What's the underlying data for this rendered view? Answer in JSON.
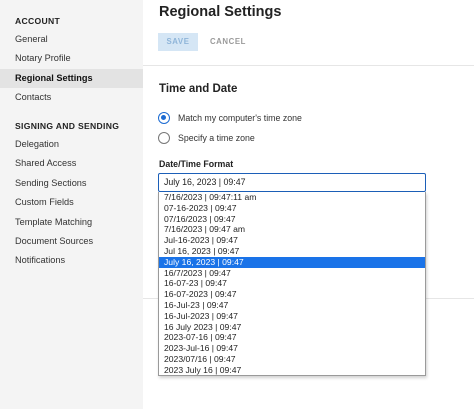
{
  "sidebar": {
    "account_heading": "ACCOUNT",
    "account_items": [
      {
        "label": "General",
        "active": false
      },
      {
        "label": "Notary Profile",
        "active": false
      },
      {
        "label": "Regional Settings",
        "active": true
      },
      {
        "label": "Contacts",
        "active": false
      }
    ],
    "signing_heading": "SIGNING AND SENDING",
    "signing_items": [
      {
        "label": "Delegation"
      },
      {
        "label": "Shared Access"
      },
      {
        "label": "Sending Sections"
      },
      {
        "label": "Custom Fields"
      },
      {
        "label": "Template Matching"
      },
      {
        "label": "Document Sources"
      },
      {
        "label": "Notifications"
      }
    ]
  },
  "main": {
    "title": "Regional Settings",
    "save_label": "SAVE",
    "cancel_label": "CANCEL",
    "section_title": "Time and Date",
    "radio_options": [
      {
        "label": "Match my computer's time zone",
        "checked": true
      },
      {
        "label": "Specify a time zone",
        "checked": false
      }
    ],
    "datetime_label": "Date/Time Format",
    "datetime_value": "July 16, 2023 | 09:47",
    "datetime_options": [
      "7/16/2023 | 09:47:11 am",
      "07-16-2023 | 09:47",
      "07/16/2023 | 09:47",
      "7/16/2023 | 09:47 am",
      "Jul-16-2023 | 09:47",
      "Jul 16, 2023 | 09:47",
      "July 16, 2023 | 09:47",
      "16/7/2023 | 09:47",
      "16-07-23 | 09:47",
      "16-07-2023 | 09:47",
      "16-Jul-23 | 09:47",
      "16-Jul-2023 | 09:47",
      "16 July 2023 | 09:47",
      "2023-07-16 | 09:47",
      "2023-Jul-16 | 09:47",
      "2023/07/16 | 09:47",
      "2023 July 16 | 09:47"
    ],
    "datetime_selected_index": 6
  },
  "colors": {
    "accent": "#1c6bd2",
    "selected_bg": "#1a73e8",
    "sidebar_bg": "#f4f4f4"
  }
}
